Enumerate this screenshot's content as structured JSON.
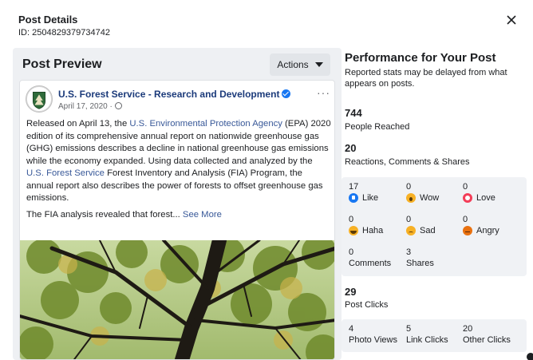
{
  "header": {
    "title": "Post Details",
    "id_text": "ID: 2504829379734742",
    "close_icon": "close-icon"
  },
  "preview": {
    "title": "Post Preview",
    "actions_label": "Actions",
    "post": {
      "page_name": "U.S. Forest Service - Research and Development",
      "date": "April 17, 2020 ·",
      "more": "···",
      "p1_a": "Released on April 13, the ",
      "p1_link1": "U.S. Environmental Protection Agency",
      "p1_b": " (EPA) 2020 edition of its comprehensive annual report on nationwide greenhouse gas (GHG) emissions describes a decline in national greenhouse gas emissions while the economy expanded. Using data collected and analyzed by the ",
      "p1_link2": "U.S. Forest Service",
      "p1_c": " Forest Inventory and Analysis (FIA) Program, the annual report also describes the power of forests to offset greenhouse gas emissions.",
      "p2": "The FIA analysis revealed that forest...",
      "see_more": "See More"
    }
  },
  "performance": {
    "title": "Performance for Your Post",
    "subtitle": "Reported stats may be delayed from what appears on posts.",
    "reached": {
      "value": "744",
      "label": "People Reached"
    },
    "engagement": {
      "value": "20",
      "label": "Reactions, Comments & Shares"
    },
    "reactions": [
      {
        "value": "17",
        "label": "Like",
        "icon": "like-icon"
      },
      {
        "value": "0",
        "label": "Wow",
        "icon": "wow-icon"
      },
      {
        "value": "0",
        "label": "Love",
        "icon": "love-icon"
      },
      {
        "value": "0",
        "label": "Haha",
        "icon": "haha-icon"
      },
      {
        "value": "0",
        "label": "Sad",
        "icon": "sad-icon"
      },
      {
        "value": "0",
        "label": "Angry",
        "icon": "angry-icon"
      }
    ],
    "comments": {
      "value": "0",
      "label": "Comments"
    },
    "shares": {
      "value": "3",
      "label": "Shares"
    },
    "clicks": {
      "value": "29",
      "label": "Post Clicks"
    },
    "click_breakdown": [
      {
        "value": "4",
        "label": "Photo Views"
      },
      {
        "value": "5",
        "label": "Link Clicks"
      },
      {
        "value": "20",
        "label": "Other Clicks"
      }
    ]
  },
  "colors": {
    "link": "#385898",
    "page_name": "#1b3a7a",
    "like": "#1877f2",
    "love": "#f33e58",
    "angry": "#e9710f"
  }
}
